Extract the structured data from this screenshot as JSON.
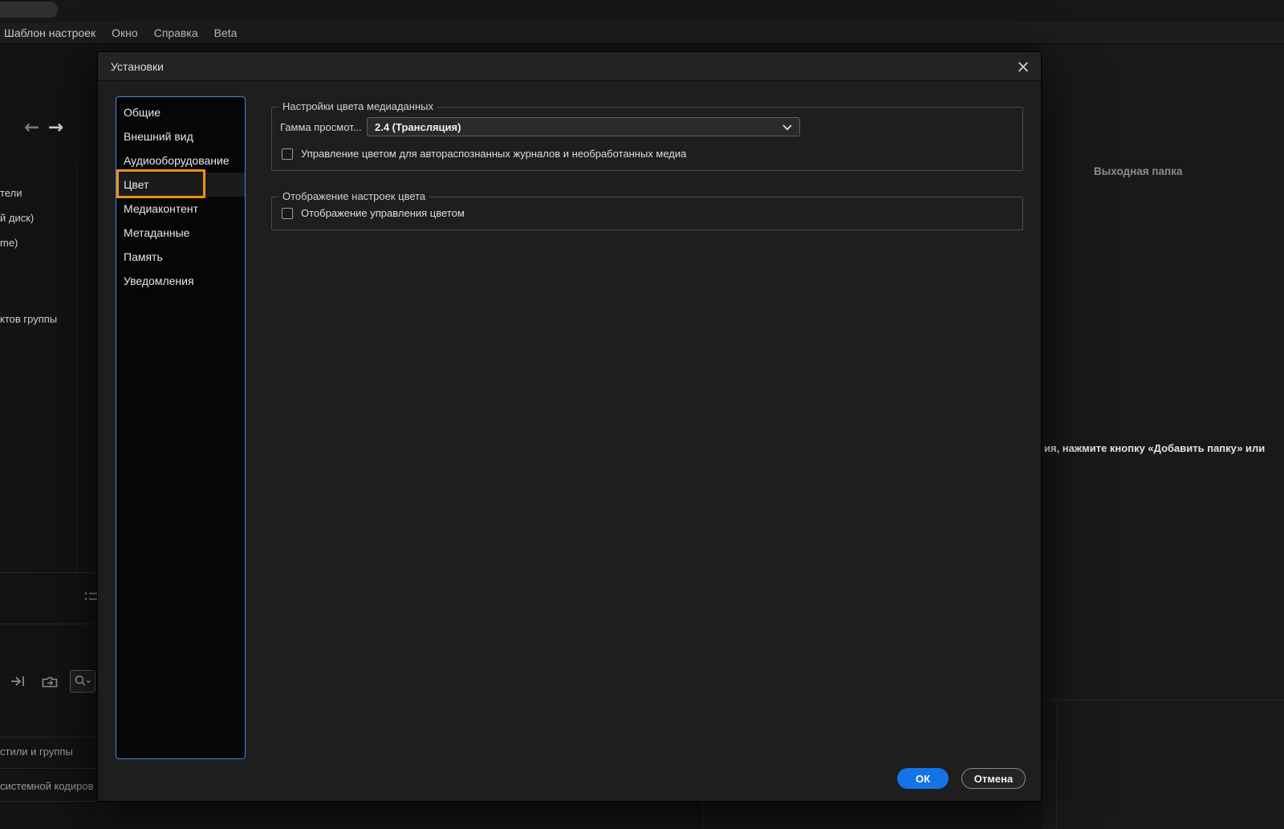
{
  "window": {
    "menu_items": [
      "Шаблон настроек",
      "Окно",
      "Справка",
      "Beta"
    ]
  },
  "dialog": {
    "title": "Установки",
    "close_label": "×",
    "sidebar_items": [
      "Общие",
      "Внешний вид",
      "Аудиооборудование",
      "Цвет",
      "Медиаконтент",
      "Метаданные",
      "Память",
      "Уведомления"
    ],
    "selected_item": "Цвет",
    "media_color_group": {
      "legend": "Настройки цвета медиаданных",
      "gamma_label": "Гамма просмот...",
      "gamma_value": "2.4 (Трансляция)",
      "checkbox_label": "Управление цветом для автораспознанных журналов и необработанных медиа",
      "checkbox_checked": false
    },
    "display_color_group": {
      "legend": "Отображение настроек цвета",
      "checkbox_label": "Отображение управления цветом",
      "checkbox_checked": false
    },
    "ok_label": "ОК",
    "cancel_label": "Отмена"
  },
  "background": {
    "output_folder_header": "Выходная папка",
    "add_folder_hint": "ия, нажмите кнопку «Добавить папку» или",
    "left_fragment_1": "тели",
    "left_fragment_2": "й диск)",
    "left_fragment_3": "me)",
    "left_fragment_4": "ктов группы",
    "bottom_fragment_1": "стили и группы",
    "bottom_fragment_2": "системной кодиров"
  },
  "colors": {
    "accent_blue": "#1473e6",
    "highlight_orange": "#ed9013",
    "focus_border": "#3f87d9"
  }
}
